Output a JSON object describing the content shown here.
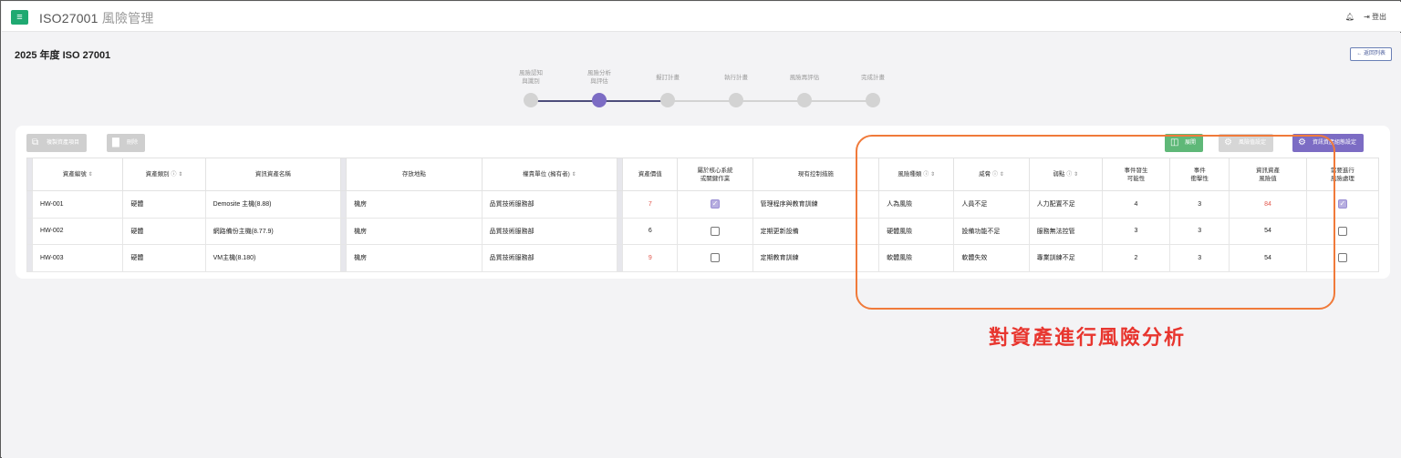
{
  "app": {
    "title": "ISO27001",
    "subtitle": "風險管理",
    "menu_icon": "menu-icon"
  },
  "top_right": {
    "bell_icon": "bell-icon",
    "logout_label": "登出"
  },
  "page": {
    "title": "2025 年度 ISO 27001",
    "back_label": "← 返回列表"
  },
  "steps": [
    {
      "label_1": "風險認知",
      "label_2": "與識別",
      "active": false
    },
    {
      "label_1": "風險分析",
      "label_2": "與評估",
      "active": true
    },
    {
      "label_1": "擬訂計畫",
      "label_2": "",
      "active": false
    },
    {
      "label_1": "執行計畫",
      "label_2": "",
      "active": false
    },
    {
      "label_1": "風險再評估",
      "label_2": "",
      "active": false
    },
    {
      "label_1": "完成計畫",
      "label_2": "",
      "active": false
    }
  ],
  "toolbar": {
    "copy_label": "複製資產項目",
    "delete_label": "刪除",
    "expand_label": "展開",
    "risk_settings_label": "風險值設定",
    "asset_group_settings_label": "資訊資產組態設定",
    "colors": {
      "green": "#5fb878",
      "purple": "#7c6cc4"
    }
  },
  "table": {
    "headers": {
      "asset_id": "資產編號",
      "asset_type": "資產類別",
      "asset_name": "資訊資產名稱",
      "location": "存放地點",
      "owner": "權責單位 (擁有者)",
      "asset_value": "資產價值",
      "core_1": "屬於核心系統",
      "core_2": "或關鍵作業",
      "controls": "現有控制措施",
      "risk_type": "風險種類",
      "threat": "威脅",
      "vulnerability": "弱點",
      "likelihood_1": "事件發生",
      "likelihood_2": "可能性",
      "impact_1": "事件",
      "impact_2": "衝擊性",
      "risk_value_1": "資訊資產",
      "risk_value_2": "風險值",
      "treat_1": "需要進行",
      "treat_2": "風險處理"
    },
    "rows": [
      {
        "asset_id": "HW-001",
        "asset_type": "硬體",
        "asset_name": "Demosite 主機(8.88)",
        "location": "機房",
        "owner": "品質技術服務部",
        "asset_value": "7",
        "core": true,
        "controls": "管理程序與教育訓練",
        "risk_type": "人為風險",
        "threat": "人員不足",
        "vulnerability": "人力配置不足",
        "likelihood": "4",
        "impact": "3",
        "risk_value": "84",
        "treat": true
      },
      {
        "asset_id": "HW-002",
        "asset_type": "硬體",
        "asset_name": "網路備份主機(8.77.9)",
        "location": "機房",
        "owner": "品質技術服務部",
        "asset_value": "6",
        "core": false,
        "controls": "定期更新設備",
        "risk_type": "硬體風險",
        "threat": "設備功能不足",
        "vulnerability": "服務無法控管",
        "likelihood": "3",
        "impact": "3",
        "risk_value": "54",
        "treat": false
      },
      {
        "asset_id": "HW-003",
        "asset_type": "硬體",
        "asset_name": "VM主機(8.180)",
        "location": "機房",
        "owner": "品質技術服務部",
        "asset_value": "9",
        "core": false,
        "controls": "定期教育訓練",
        "risk_type": "軟體風險",
        "threat": "軟體失效",
        "vulnerability": "專業訓練不足",
        "likelihood": "2",
        "impact": "3",
        "risk_value": "54",
        "treat": false
      }
    ]
  },
  "annotation": {
    "text": "對資產進行風險分析",
    "color": "#e8362f"
  }
}
